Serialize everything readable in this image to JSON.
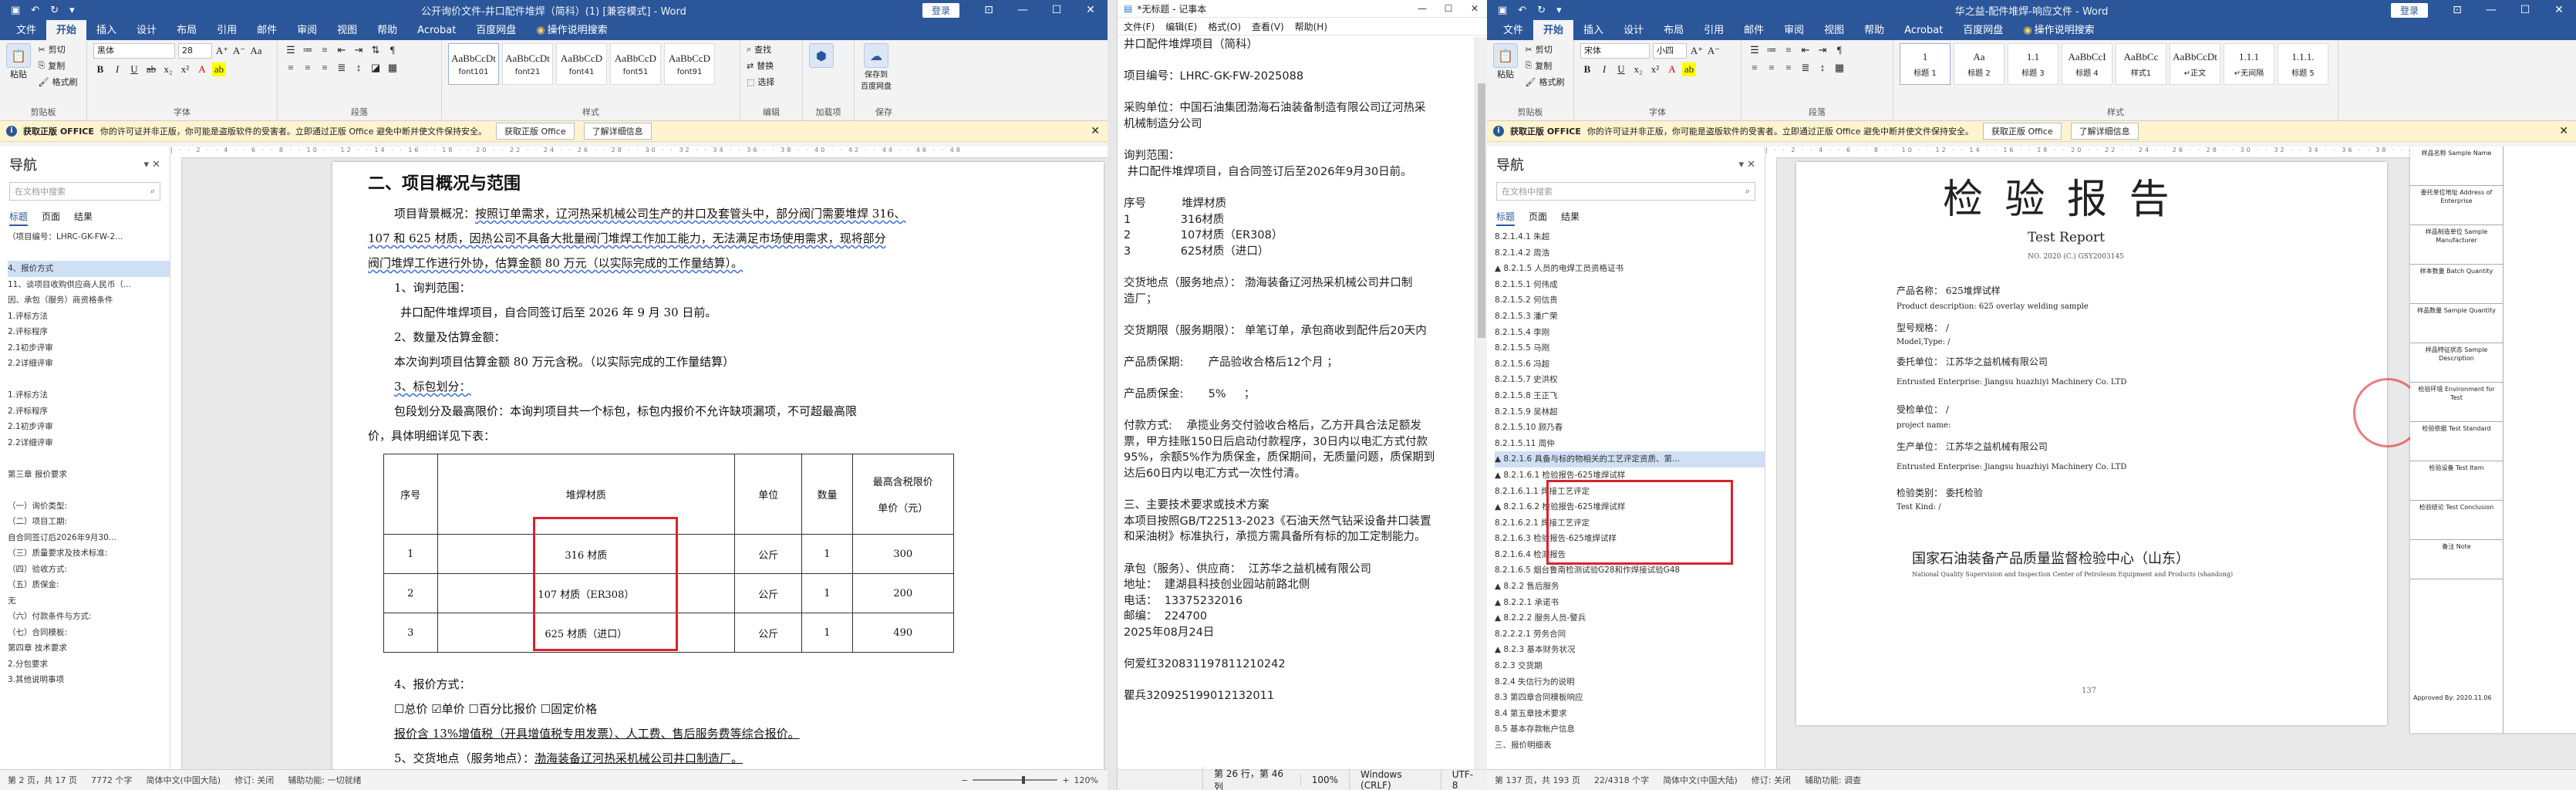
{
  "left_word": {
    "title": "公开询价文件-井口配件堆焊（简科）(1) [兼容模式] - Word",
    "login": "登录",
    "tabs": [
      "文件",
      "开始",
      "插入",
      "设计",
      "布局",
      "引用",
      "邮件",
      "审阅",
      "视图",
      "帮助",
      "Acrobat",
      "百度网盘",
      "操作说明搜索"
    ],
    "ribbon": {
      "paste": "粘贴",
      "cut": "剪切",
      "copy": "复制",
      "format_painter": "格式刷",
      "clipboard": "剪贴板",
      "font_name": "黑体",
      "font_size": "28",
      "font": "字体",
      "paragraph": "段落",
      "style_samples": [
        "AaBbCcDt",
        "AaBbCcDt",
        "AaBbCcD",
        "AaBbCcD",
        "AaBbCcD"
      ],
      "styles": [
        "font101",
        "font21",
        "font41",
        "font51",
        "font91"
      ],
      "styles_group": "样式",
      "find": "查找",
      "replace": "替换",
      "select": "选择",
      "editing": "编辑",
      "load_item": "加载项",
      "save_baidu": "保存到\n百度网盘",
      "save": "保存"
    },
    "notice": {
      "badge": "获取正版 OFFICE",
      "text": "你的许可证并非正版，你可能是盗版软件的受害者。立即通过正版 Office 避免中断并使文件保持安全。",
      "btn1": "获取正版 Office",
      "btn2": "了解详细信息"
    },
    "nav": {
      "title": "导航",
      "search": "在文档中搜索",
      "tabs": [
        "标题",
        "页面",
        "结果"
      ],
      "items": [
        "（项目编号：LHRC-GK-FW-2...",
        "",
        "4、报价方式",
        "11、谈项目收购供应商人民币（...",
        "因、承包（服务）商资格条件",
        "1.评标方法",
        "2.评标程序",
        "2.1初步评审",
        "2.2详细评审",
        "",
        "1.评标方法",
        "2.评标程序",
        "2.1初步评审",
        "2.2详细评审",
        "",
        "第三章 报价要求",
        "",
        "（一）询价类型:",
        "（二）项目工期:",
        "自合同签订后2026年9月30...",
        "（三）质量要求及技术标准:",
        "（四）验收方式:",
        "（五）质保金:",
        "无",
        "（六）付款条件与方式:",
        "（七）合同模板:",
        "第四章 技术要求",
        "2.分包要求",
        "3.其他说明事项"
      ]
    },
    "doc": {
      "heading": "二、项目概况与范围",
      "p1a": "项目背景概况：",
      "p1b": "按照订单需求，辽河热采机械公司生产的井口及套管头中，部分阀门需要堆焊 316、",
      "p1c": "107 和 625 材质，因热公司不具备大批量阀门堆焊工作加工能力，无法满足市场使用需求，现将部分",
      "p1d": "阀门堆焊工作进行外协，估算金额 80 万元（以实际完成的工作量结算）。",
      "l1": "1、询判范围：",
      "l1v": "井口配件堆焊项目，自合同签订后至 2026 年 9 月 30 日前。",
      "l2": "2、数量及估算金额：",
      "l2v": "本次询判项目估算金额 80 万元含税。（以实际完成的工作量结算）",
      "l3": "3、标包划分：",
      "l3v1": "包段划分及最高限价：本询判项目共一个标包，标包内报价不允许缺项漏项，不可超最高限",
      "l3v2": "价，具体明细详见下表：",
      "table_head": [
        "序号",
        "堆焊材质",
        "单位",
        "数量",
        "最高含税限价",
        "单价（元）"
      ],
      "table_rows": [
        [
          "1",
          "316 材质",
          "公斤",
          "1",
          "300"
        ],
        [
          "2",
          "107 材质（ER308）",
          "公斤",
          "1",
          "200"
        ],
        [
          "3",
          "625 材质（进口）",
          "公斤",
          "1",
          "490"
        ]
      ],
      "l4": "4、报价方式：",
      "l4v": "☐总价  ☑单价  ☐百分比报价  ☐固定价格",
      "l4n": "报价含 13%增值税（开具增值税专用发票）、人工费、售后服务费等综合报价。",
      "l5a": "5、交货地点（服务地点）：",
      "l5b": "渤海装备辽河热采机械公司井口制造厂。"
    },
    "status": {
      "page": "第 2 页，共 17 页",
      "words": "7772 个字",
      "lang": "简体中文(中国大陆)",
      "track": "修订: 关闭",
      "access": "辅助功能: 一切就绪",
      "zoom": "120%"
    }
  },
  "notepad": {
    "title": "*无标题 - 记事本",
    "menu": [
      "文件(F)",
      "编辑(E)",
      "格式(O)",
      "查看(V)",
      "帮助(H)"
    ],
    "lines": [
      "井口配件堆焊项目（简科）",
      "",
      "项目编号：LHRC-GK-FW-2025088",
      "",
      "采购单位：中国石油集团渤海石油装备制造有限公司辽河热采",
      "机械制造分公司",
      "",
      "询判范围：",
      " 井口配件堆焊项目，自合同签订后至2026年9月30日前。",
      "",
      "序号          堆焊材质",
      "1              316材质",
      "2              107材质（ER308）",
      "3              625材质（进口）",
      "",
      "交货地点（服务地点）： 渤海装备辽河热采机械公司井口制",
      "造厂；",
      "",
      "交货期限（服务期限）： 单笔订单，承包商收到配件后20天内",
      "",
      "产品质保期:       产品验收合格后12个月 ；",
      "",
      "产品质保金:       5%     ；",
      "",
      "付款方式:    承揽业务交付验收合格后，乙方开具合法足额发",
      "票，甲方挂账150日后启动付款程序，30日内以电汇方式付款",
      "95%，余额5%作为质保金，质保期间，无质量问题，质保期到",
      "达后60日内以电汇方式一次性付清。",
      "",
      "三、主要技术要求或技术方案",
      "本项目按照GB/T22513-2023《石油天然气钻采设备井口装置",
      "和采油树》标准执行，承揽方需具备所有标的加工定制能力。",
      "",
      "承包（服务）、供应商：  江苏华之益机械有限公司",
      "地址：  建湖县科技创业园站前路北侧",
      "电话：  13375232016",
      "邮编：  224700",
      "2025年08月24日",
      "",
      "何爱红320831197811210242",
      "",
      "瞿兵320925199012132011"
    ],
    "status": [
      "第 26 行，第 46 列",
      "100%",
      "Windows (CRLF)",
      "UTF-8"
    ]
  },
  "right_word": {
    "title": "华之益-配件堆焊-响应文件 - Word",
    "login": "登录",
    "tabs": [
      "文件",
      "开始",
      "插入",
      "设计",
      "布局",
      "引用",
      "邮件",
      "审阅",
      "视图",
      "帮助",
      "Acrobat",
      "百度网盘",
      "操作说明搜索"
    ],
    "ribbon": {
      "paste": "粘贴",
      "cut": "剪切",
      "copy": "复制",
      "format_painter": "格式刷",
      "clipboard": "剪贴板",
      "font_name": "宋体",
      "font_size": "小四",
      "font": "字体",
      "paragraph": "段落",
      "style_samples": [
        "1",
        "Aa",
        "1.1",
        "AaBbCcI",
        "AaBbCc",
        "AaBbCcDt",
        "1.1.1",
        "1.1.1."
      ],
      "styles": [
        "标题 1",
        "标题 2",
        "标题 3",
        "标题 4",
        "样式1",
        "↵正文",
        "↵无间隔",
        "标题 5"
      ],
      "styles_group": "样式"
    },
    "notice": {
      "badge": "获取正版 OFFICE",
      "text": "你的许可证并非正版，你可能是盗版软件的受害者。立即通过正版 Office 避免中断并使文件保持安全。",
      "btn1": "获取正版 Office",
      "btn2": "了解详细信息"
    },
    "nav": {
      "title": "导航",
      "search": "在文档中搜索",
      "tabs": [
        "标题",
        "页面",
        "结果"
      ],
      "items": [
        "8.2.1.4.1 朱超",
        "8.2.1.4.2 周浩",
        "▲ 8.2.1.5 人员的电焊工员资格证书",
        "8.2.1.5.1 何伟成",
        "8.2.1.5.2 何信贵",
        "8.2.1.5.3 潘广荣",
        "8.2.1.5.4 李刚",
        "8.2.1.5.5 马刚",
        "8.2.1.5.6 冯超",
        "8.2.1.5.7 史洪权",
        "8.2.1.5.8 王正飞",
        "8.2.1.5.9 吴林超",
        "8.2.1.5.10 顾乃春",
        "8.2.1.5.11 周仲",
        "▲ 8.2.1.6 具备与标的物相关的工艺评定资质、第...",
        "▲ 8.2.1.6.1 检验报告-625堆焊试样",
        "8.2.1.6.1.1 焊接工艺评定",
        "▲ 8.2.1.6.2 检验报告-625堆焊试样",
        "8.2.1.6.2.1 焊接工艺评定",
        "8.2.1.6.3 检验报告-625堆焊试样",
        "8.2.1.6.4 检测报告",
        "8.2.1.6.5 烟台鲁南检测试验G28和作焊接试验G48",
        "▲ 8.2.2 售后服务",
        "▲ 8.2.2.1 承诺书",
        "▲ 8.2.2.2 服务人员-警兵",
        "8.2.2.2.1 劳务合同",
        "▲ 8.2.3 基本财务状况",
        "8.2.3 交货期",
        "8.2.4 失信行为的说明",
        "8.3 第四章合同模板响应",
        "8.4 第五章技术要求",
        "8.5 基本存款帐户信息",
        "三、报价明细表"
      ]
    },
    "report": {
      "title": "检 验 报 告",
      "subtitle": "Test     Report",
      "no": "NO. 2020 (C.) GSY2003145",
      "product_cn": "产品名称：  625堆焊试样",
      "product_en": "Product description: 625 overlay welding sample",
      "model": "型号规格：  /",
      "model_en": "Model,Type: /",
      "client": "委托单位：  江苏华之益机械有限公司",
      "client_en": "Entrusted Enterprise: Jiangsu huazhiyi Machinery Co. LTD",
      "inspected": "受检单位：  /",
      "inspected_en": "project name:",
      "maker": "生产单位：  江苏华之益机械有限公司",
      "maker_en": "Entrusted Enterprise: Jiangsu huazhiyi Machinery Co. LTD",
      "type": "检验类别：  委托检验",
      "type_en": "Test Kind: /",
      "center_cn": "国家石油装备产品质量监督检验中心（山东）",
      "center_en": "National Quality Supervision and Inspection Center of Petroleum Equipment and Products (shandong)",
      "page_no": "137",
      "side_cells": [
        "样品名称 Sample Name",
        "委托单位地址 Address of Enterprise",
        "样品制造单位 Sample Manufacturer",
        "样本数量 Batch Quantity",
        "样品数量 Sample Quantity",
        "样品特征状态 Sample Description",
        "检验环境 Environment for Test",
        "检验依据 Test Standard",
        "检验设备 Test Item",
        "检验结论 Test Conclusion",
        "备注 Note"
      ],
      "side_approved": "Approved By:   2020.11.06"
    },
    "status": {
      "page": "第 137 页，共 193 页",
      "words": "22/4318 个字",
      "lang": "简体中文(中国大陆)",
      "track": "修订: 关闭",
      "access": "辅助功能: 调查"
    }
  },
  "colors": {
    "word_blue": "#2b579a",
    "highlight_red": "#d9232e",
    "notice_bg": "#fff4ce"
  }
}
